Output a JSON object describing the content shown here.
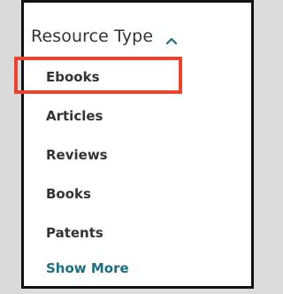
{
  "facet": {
    "title": "Resource Type",
    "expanded_icon": "chevron-up-icon",
    "accent_color": "#1d6f80",
    "highlight_color": "#e8442f",
    "items": [
      {
        "label": "Ebooks",
        "highlighted": true
      },
      {
        "label": "Articles"
      },
      {
        "label": "Reviews"
      },
      {
        "label": "Books"
      },
      {
        "label": "Patents"
      }
    ],
    "show_more_label": "Show More"
  }
}
